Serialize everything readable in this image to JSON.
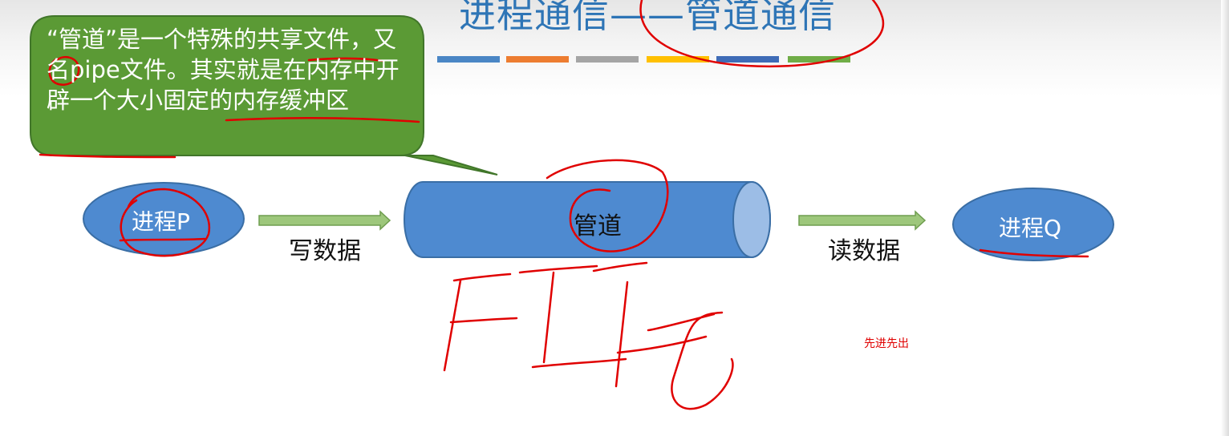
{
  "slide": {
    "title": "进程通信——管道通信"
  },
  "title_bar_colors": [
    "#4a86c5",
    "#ed7d31",
    "#a5a5a5",
    "#ffc000",
    "#3f6cb7",
    "#70ad47"
  ],
  "callout": {
    "text": "“管道”是一个特殊的共享文件，又名pipe文件。其实就是在内存中开辟一个大小固定的内存缓冲区",
    "fill_color": "#5b9a35"
  },
  "process_p": {
    "label": "进程P"
  },
  "process_q": {
    "label": "进程Q"
  },
  "pipe": {
    "label": "管道"
  },
  "write_label": "写数据",
  "read_label": "读数据",
  "note": "先进先出",
  "colors": {
    "shape_blue": "#4e8ad0",
    "arrow_green": "#9dc77b",
    "ink_red": "#e00000"
  }
}
